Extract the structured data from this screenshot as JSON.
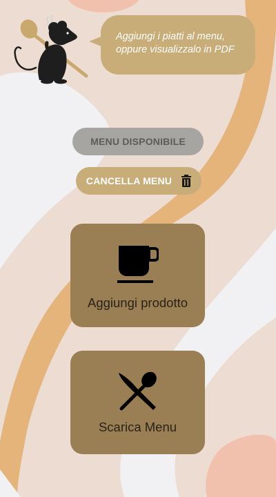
{
  "header": {
    "mascot_icon": "chef-rat-with-spoon-icon",
    "bubble_line1": "Aggiungi i piatti al menu,",
    "bubble_line2": "oppure visualizzalo in PDF"
  },
  "actions": {
    "available_label": "MENU DISPONIBILE",
    "delete_label": "CANCELLA MENU",
    "delete_icon": "trash-icon"
  },
  "cards": {
    "add_product_label": "Aggiungi prodotto",
    "add_product_icon": "coffee-cup-icon",
    "download_menu_label": "Scarica Menu",
    "download_menu_icon": "crossed-fork-spoon-icon"
  },
  "colors": {
    "background": "#ecdcd2",
    "accent": "#c8ad78",
    "card": "#9a7e54",
    "disabled_button": "#a7a5a2",
    "stripe_orange": "#e4b47a",
    "stripe_white": "#f1f0f2",
    "blob_pink": "#f2c1ad"
  }
}
